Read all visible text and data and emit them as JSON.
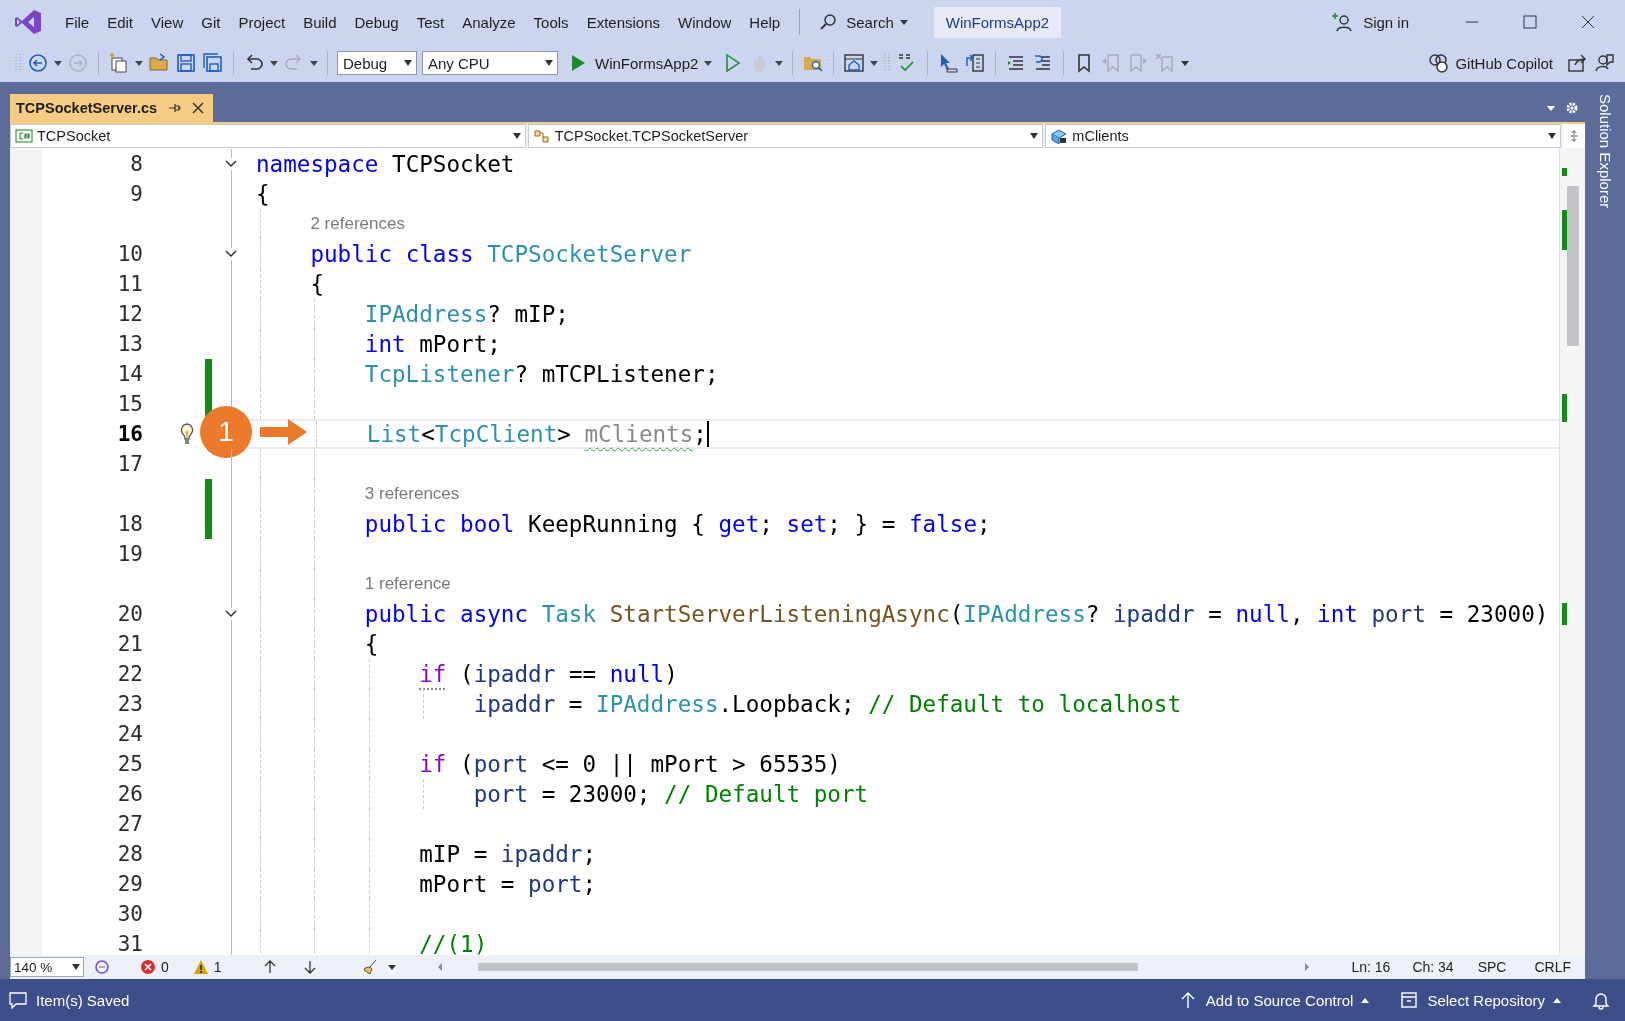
{
  "window": {
    "menu": [
      "File",
      "Edit",
      "View",
      "Git",
      "Project",
      "Build",
      "Debug",
      "Test",
      "Analyze",
      "Tools",
      "Extensions",
      "Window",
      "Help"
    ],
    "search": "Search",
    "project_badge": "WinFormsApp2",
    "sign_in": "Sign in"
  },
  "toolbar": {
    "configuration": "Debug",
    "platform": "Any CPU",
    "start_target": "WinFormsApp2",
    "copilot": "GitHub Copilot"
  },
  "tabs": [
    {
      "label": "TCPSocketServer.cs",
      "selected": true
    }
  ],
  "side_panel": {
    "label": "Solution Explorer"
  },
  "navigation": [
    "TCPSocket",
    "TCPSocket.TCPSocketServer",
    "mClients"
  ],
  "editor": {
    "lines": [
      {
        "kind": "code",
        "number": "8",
        "fold": true,
        "tokens": [
          {
            "text": "namespace",
            "kind": "keyword"
          },
          {
            "text": " TCPSocket",
            "kind": "plain"
          }
        ]
      },
      {
        "kind": "code",
        "number": "9",
        "tokens": [
          {
            "text": "{",
            "kind": "plain"
          }
        ]
      },
      {
        "kind": "codelens",
        "text": "2 references"
      },
      {
        "kind": "code",
        "number": "10",
        "fold": true,
        "tokens": [
          {
            "text": "    public",
            "kind": "keyword"
          },
          {
            "text": " class",
            "kind": "keyword"
          },
          {
            "text": " TCPSocketServer",
            "kind": "type"
          }
        ]
      },
      {
        "kind": "code",
        "number": "11",
        "tokens": [
          {
            "text": "    {",
            "kind": "plain"
          }
        ]
      },
      {
        "kind": "code",
        "number": "12",
        "tokens": [
          {
            "text": "        IPAddress",
            "kind": "type"
          },
          {
            "text": "? mIP;",
            "kind": "plain"
          }
        ]
      },
      {
        "kind": "code",
        "number": "13",
        "tokens": [
          {
            "text": "        int",
            "kind": "keyword"
          },
          {
            "text": " mPort;",
            "kind": "plain"
          }
        ]
      },
      {
        "kind": "code",
        "number": "14",
        "changed": true,
        "tokens": [
          {
            "text": "        TcpListener",
            "kind": "type"
          },
          {
            "text": "? mTCPListener;",
            "kind": "plain"
          }
        ]
      },
      {
        "kind": "code",
        "number": "15",
        "changed": true
      },
      {
        "kind": "code",
        "number": "16",
        "current": true,
        "lightbulb": true,
        "caret": true,
        "callout": "1",
        "tokens": [
          {
            "text": "        List",
            "kind": "type"
          },
          {
            "text": "<",
            "kind": "plain"
          },
          {
            "text": "TcpClient",
            "kind": "type"
          },
          {
            "text": "> ",
            "kind": "plain"
          },
          {
            "text": "mClients",
            "kind": "unused"
          },
          {
            "text": ";",
            "kind": "plain"
          }
        ]
      },
      {
        "kind": "code",
        "number": "17"
      },
      {
        "kind": "codelens",
        "text": "3 references",
        "changed": true
      },
      {
        "kind": "code",
        "number": "18",
        "changed": true,
        "tokens": [
          {
            "text": "        public",
            "kind": "keyword"
          },
          {
            "text": " bool",
            "kind": "keyword"
          },
          {
            "text": " KeepRunning { ",
            "kind": "plain"
          },
          {
            "text": "get",
            "kind": "keyword"
          },
          {
            "text": "; ",
            "kind": "plain"
          },
          {
            "text": "set",
            "kind": "keyword"
          },
          {
            "text": "; } = ",
            "kind": "plain"
          },
          {
            "text": "false",
            "kind": "keyword"
          },
          {
            "text": ";",
            "kind": "plain"
          }
        ]
      },
      {
        "kind": "code",
        "number": "19"
      },
      {
        "kind": "codelens",
        "text": "1 reference"
      },
      {
        "kind": "code",
        "number": "20",
        "fold": true,
        "tokens": [
          {
            "text": "        public",
            "kind": "keyword"
          },
          {
            "text": " async",
            "kind": "keyword"
          },
          {
            "text": " Task",
            "kind": "type"
          },
          {
            "text": " StartServerListeningAsync",
            "kind": "method"
          },
          {
            "text": "(",
            "kind": "plain"
          },
          {
            "text": "IPAddress",
            "kind": "type"
          },
          {
            "text": "? ",
            "kind": "plain"
          },
          {
            "text": "ipaddr",
            "kind": "param"
          },
          {
            "text": " = ",
            "kind": "plain"
          },
          {
            "text": "null",
            "kind": "keyword"
          },
          {
            "text": ", ",
            "kind": "plain"
          },
          {
            "text": "int",
            "kind": "keyword"
          },
          {
            "text": " port",
            "kind": "param"
          },
          {
            "text": " = 23000)",
            "kind": "plain"
          }
        ]
      },
      {
        "kind": "code",
        "number": "21",
        "tokens": [
          {
            "text": "        {",
            "kind": "plain"
          }
        ]
      },
      {
        "kind": "code",
        "number": "22",
        "tokens": [
          {
            "text": "            if",
            "kind": "control",
            "hint": true
          },
          {
            "text": " (",
            "kind": "plain"
          },
          {
            "text": "ipaddr",
            "kind": "param"
          },
          {
            "text": " == ",
            "kind": "plain"
          },
          {
            "text": "null",
            "kind": "keyword"
          },
          {
            "text": ")",
            "kind": "plain"
          }
        ]
      },
      {
        "kind": "code",
        "number": "23",
        "tokens": [
          {
            "text": "                ipaddr",
            "kind": "param"
          },
          {
            "text": " = ",
            "kind": "plain"
          },
          {
            "text": "IPAddress",
            "kind": "type"
          },
          {
            "text": ".Loopback; ",
            "kind": "plain"
          },
          {
            "text": "// Default to localhost",
            "kind": "comment"
          }
        ]
      },
      {
        "kind": "code",
        "number": "24"
      },
      {
        "kind": "code",
        "number": "25",
        "tokens": [
          {
            "text": "            if",
            "kind": "control"
          },
          {
            "text": " (",
            "kind": "plain"
          },
          {
            "text": "port",
            "kind": "param"
          },
          {
            "text": " <= 0 || mPort > 65535)",
            "kind": "plain"
          }
        ]
      },
      {
        "kind": "code",
        "number": "26",
        "tokens": [
          {
            "text": "                port",
            "kind": "param"
          },
          {
            "text": " = 23000; ",
            "kind": "plain"
          },
          {
            "text": "// Default port",
            "kind": "comment"
          }
        ]
      },
      {
        "kind": "code",
        "number": "27"
      },
      {
        "kind": "code",
        "number": "28",
        "tokens": [
          {
            "text": "            mIP = ",
            "kind": "plain"
          },
          {
            "text": "ipaddr",
            "kind": "param"
          },
          {
            "text": ";",
            "kind": "plain"
          }
        ]
      },
      {
        "kind": "code",
        "number": "29",
        "tokens": [
          {
            "text": "            mPort = ",
            "kind": "plain"
          },
          {
            "text": "port",
            "kind": "param"
          },
          {
            "text": ";",
            "kind": "plain"
          }
        ]
      },
      {
        "kind": "code",
        "number": "30"
      },
      {
        "kind": "code",
        "number": "31",
        "tokens": [
          {
            "text": "            //(1)",
            "kind": "comment"
          }
        ]
      }
    ]
  },
  "editor_status": {
    "zoom": "140 %",
    "errors": "0",
    "warnings": "1",
    "line": "Ln: 16",
    "column": "Ch: 34",
    "whitespace": "SPC",
    "line_endings": "CRLF"
  },
  "status_bar": {
    "message": "Item(s) Saved",
    "source_control": "Add to Source Control",
    "repository": "Select Repository"
  }
}
